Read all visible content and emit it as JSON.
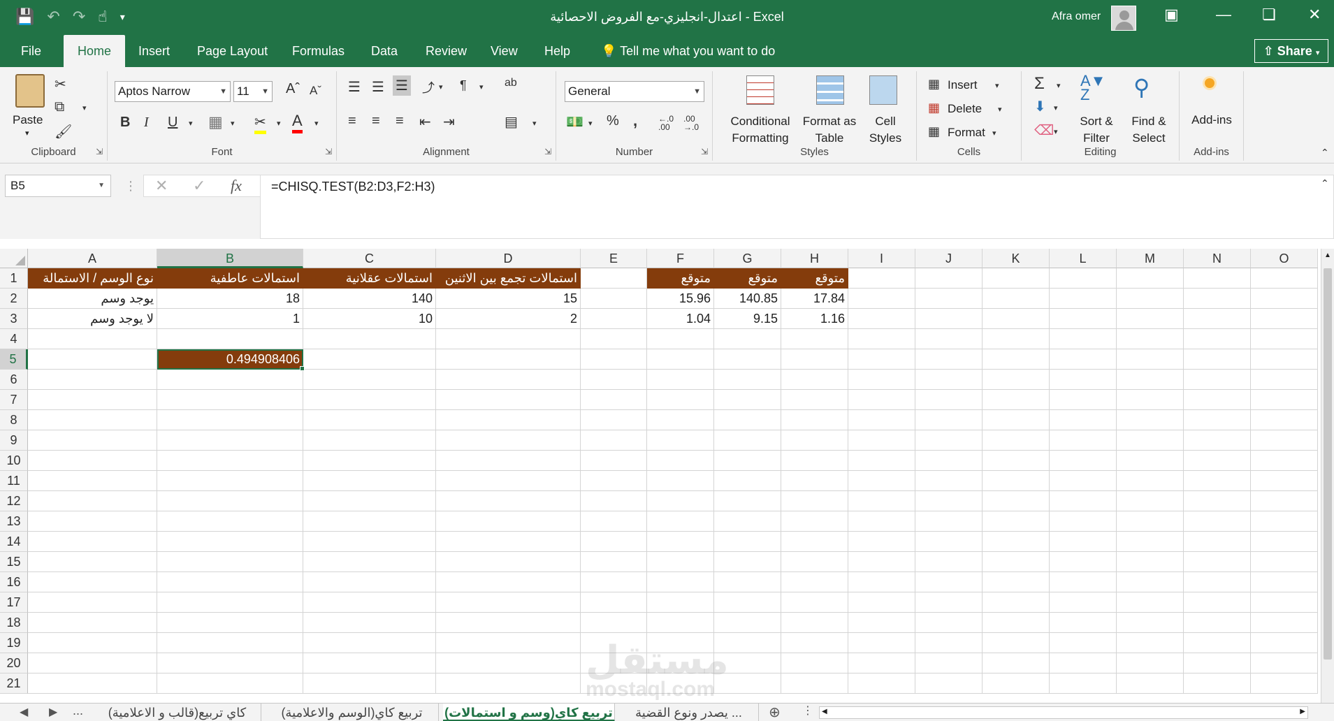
{
  "title_bar": {
    "title": "اعتدال-انجليزي-مع الفروض الاحصائية  -  Excel",
    "user": "Afra omer"
  },
  "tabs": [
    "File",
    "Home",
    "Insert",
    "Page Layout",
    "Formulas",
    "Data",
    "Review",
    "View",
    "Help"
  ],
  "tell_me": "Tell me what you want to do",
  "share_label": "Share",
  "ribbon": {
    "clipboard": {
      "paste": "Paste",
      "label": "Clipboard"
    },
    "font": {
      "name": "Aptos Narrow",
      "size": "11",
      "label": "Font"
    },
    "alignment": {
      "label": "Alignment"
    },
    "number": {
      "format": "General",
      "label": "Number"
    },
    "styles": {
      "conditional": "Conditional Formatting",
      "format_as": "Format as Table",
      "cell_styles": "Cell Styles",
      "label": "Styles"
    },
    "cells": {
      "insert": "Insert",
      "delete": "Delete",
      "format": "Format",
      "label": "Cells"
    },
    "editing": {
      "sort": "Sort & Filter",
      "find": "Find & Select",
      "label": "Editing"
    },
    "addins": {
      "addins": "Add-ins",
      "label": "Add-ins"
    }
  },
  "formula_bar": {
    "name_box": "B5",
    "formula": "=CHISQ.TEST(B2:D3,F2:H3)"
  },
  "columns": [
    "A",
    "B",
    "C",
    "D",
    "E",
    "F",
    "G",
    "H",
    "I",
    "J",
    "K",
    "L",
    "M",
    "N",
    "O"
  ],
  "rows": [
    "1",
    "2",
    "3",
    "4",
    "5",
    "6",
    "7",
    "8",
    "9",
    "10",
    "11",
    "12",
    "13",
    "14",
    "15",
    "16",
    "17",
    "18",
    "19",
    "20",
    "21"
  ],
  "cells": {
    "A1": "نوع الوسم / الاستمالة",
    "B1": "استمالات عاطفية",
    "C1": "استمالات عقلانية",
    "D1": "استمالات تجمع بين الاثنين",
    "F1": "متوقع",
    "G1": "متوقع",
    "H1": "متوقع",
    "A2": "يوجد وسم",
    "B2": "18",
    "C2": "140",
    "D2": "15",
    "F2": "15.96",
    "G2": "140.85",
    "H2": "17.84",
    "A3": "لا يوجد وسم",
    "B3": "1",
    "C3": "10",
    "D3": "2",
    "F3": "1.04",
    "G3": "9.15",
    "H3": "1.16",
    "B5": "0.494908406"
  },
  "sheet_tabs": [
    "... يصدر ونوع القضية",
    "تربيع كاي(وسم و استمالات)",
    "تربيع كاي(الوسم والاعلامية)",
    "كاي تربيع(قالب و الاعلامية)"
  ],
  "watermark": {
    "ar": "مستقل",
    "en": "mostaql.com"
  },
  "accent_color": "#217346",
  "header_fill_color": "#843c0c"
}
